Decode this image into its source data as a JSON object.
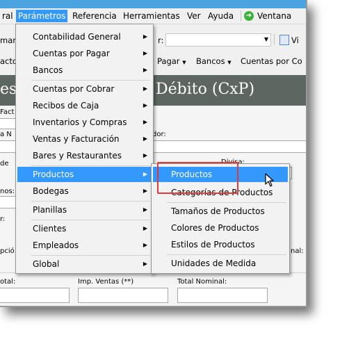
{
  "menubar": {
    "items": [
      {
        "label": "ral",
        "active": false
      },
      {
        "label": "Parámetros",
        "active": true
      },
      {
        "label": "Referencia",
        "active": false
      },
      {
        "label": "Herramientas",
        "active": false
      },
      {
        "label": "Ver",
        "active": false
      },
      {
        "label": "Ayuda",
        "active": false
      },
      {
        "label": "Ventana",
        "active": false
      }
    ],
    "window_icon": "ventana-globe-icon"
  },
  "toolbar1": {
    "left_label": "mar:",
    "right_label": "r:",
    "vis_label": "Vi"
  },
  "toolbar2": {
    "left_label": "acto",
    "items": [
      "Pagar",
      "Bancos",
      "Cuentas por Co"
    ]
  },
  "title": {
    "left": "es",
    "right": "Débito (CxP)"
  },
  "form": {
    "labels": [
      "Fact",
      "a N",
      "dor:",
      "de",
      "Divisa:",
      "nos:",
      "r:",
      "pció",
      "nal:",
      "otal:",
      "Imp. Ventas (**)",
      "Total Nominal:"
    ]
  },
  "main_menu": {
    "items": [
      {
        "label": "Contabilidad General",
        "submenu": true
      },
      {
        "label": "Cuentas por Pagar",
        "submenu": true
      },
      {
        "label": "Bancos",
        "submenu": true
      },
      {
        "label": "Cuentas por Cobrar",
        "submenu": true
      },
      {
        "label": "Recibos de Caja",
        "submenu": true
      },
      {
        "label": "Inventarios y Compras",
        "submenu": true
      },
      {
        "label": "Ventas y Facturación",
        "submenu": true
      },
      {
        "label": "Bares y Restaurantes",
        "submenu": true
      },
      {
        "label": "Productos",
        "submenu": true,
        "highlighted": true
      },
      {
        "label": "Bodegas",
        "submenu": true
      },
      {
        "label": "Planillas",
        "submenu": true
      },
      {
        "label": "Clientes",
        "submenu": true
      },
      {
        "label": "Empleados",
        "submenu": true
      },
      {
        "label": "Global",
        "submenu": true
      }
    ]
  },
  "sub_menu": {
    "items": [
      {
        "label": "Productos",
        "highlighted": true
      },
      {
        "label": "Categorías de Productos"
      },
      {
        "label": "Tamaños de Productos"
      },
      {
        "label": "Colores de Productos"
      },
      {
        "label": "Estilos de Productos"
      },
      {
        "label": "Unidades de Medida"
      }
    ]
  },
  "colors": {
    "menu_highlight": "#3399ff",
    "annotation_box": "#e03a3a",
    "title_bar": "#5d6660",
    "top_strip": "#4ba3e0"
  }
}
